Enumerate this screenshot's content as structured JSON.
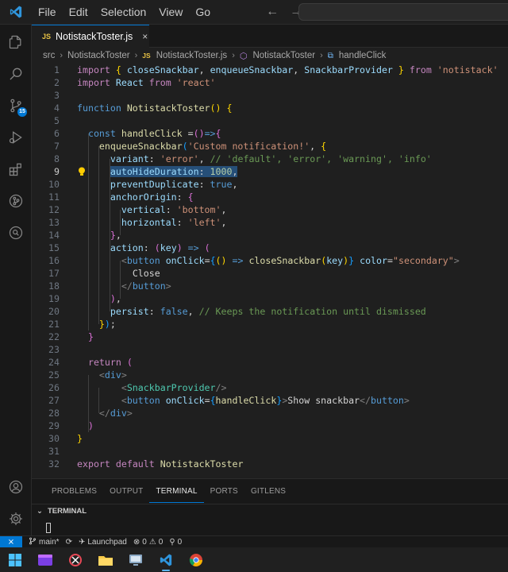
{
  "menu": [
    "File",
    "Edit",
    "Selection",
    "View",
    "Go"
  ],
  "tab": {
    "badge": "JS",
    "label": "NotistackToster.js",
    "close": "×"
  },
  "breadcrumbs": {
    "folder": "src",
    "folder2": "NotistackToster",
    "file_badge": "JS",
    "file": "NotistackToster.js",
    "component": "NotistackToster",
    "method": "handleClick"
  },
  "editor": {
    "active_line": 9,
    "line_numbers": [
      "1",
      "2",
      "3",
      "4",
      "5",
      "6",
      "7",
      "8",
      "9",
      "10",
      "11",
      "12",
      "13",
      "14",
      "15",
      "16",
      "17",
      "18",
      "19",
      "20",
      "21",
      "22",
      "23",
      "24",
      "25",
      "26",
      "27",
      "28",
      "29",
      "30",
      "31",
      "32"
    ]
  },
  "panel": {
    "tabs": [
      "PROBLEMS",
      "OUTPUT",
      "TERMINAL",
      "PORTS",
      "GITLENS"
    ],
    "active_tab": "TERMINAL",
    "terminal_title": "TERMINAL"
  },
  "status": {
    "branch": "main*",
    "launchpad": "Launchpad",
    "errors": "0",
    "warnings": "0",
    "info": "0"
  },
  "badges": {
    "source_control": "15"
  },
  "icons": [
    "explorer-icon",
    "search-icon",
    "source-control-icon",
    "run-debug-icon",
    "extensions-icon",
    "gitlens-icon",
    "remote-explorer-icon",
    "accounts-icon",
    "settings-icon"
  ],
  "colors": {
    "accent": "#0078d4",
    "editor_bg": "#1f1f1f",
    "selection": "#264f78"
  }
}
